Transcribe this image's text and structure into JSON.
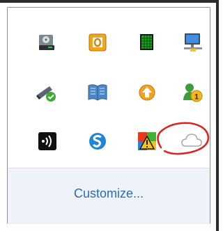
{
  "tray": {
    "icons": [
      {
        "name": "removable-drive-icon"
      },
      {
        "name": "office-upload-icon"
      },
      {
        "name": "green-chip-icon"
      },
      {
        "name": "network-connection-icon"
      },
      {
        "name": "safely-remove-usb-icon"
      },
      {
        "name": "book-icon"
      },
      {
        "name": "orange-update-arrow-icon"
      },
      {
        "name": "user-badge-icon",
        "badge": "1"
      },
      {
        "name": "sound-wave-icon"
      },
      {
        "name": "blue-s-icon"
      },
      {
        "name": "action-center-warning-icon"
      },
      {
        "name": "cloud-sync-icon"
      }
    ],
    "highlight_color": "#e0201c"
  },
  "footer": {
    "customize_label": "Customize...",
    "link_color": "#2a6cb3"
  }
}
